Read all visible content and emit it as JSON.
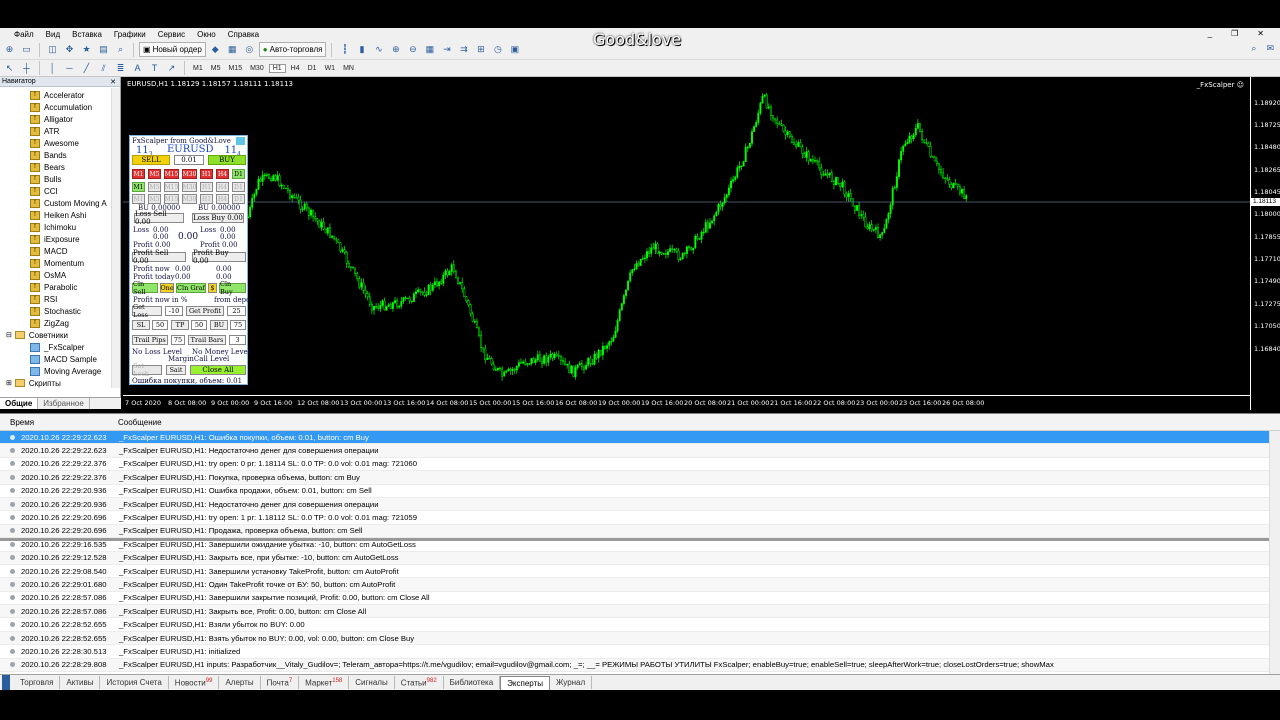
{
  "watermark": "Good&love",
  "menu": [
    "Файл",
    "Вид",
    "Вставка",
    "Графики",
    "Сервис",
    "Окно",
    "Справка"
  ],
  "toolbar": {
    "new_order": "Новый ордер",
    "auto_trading": "Авто-торговля",
    "timeframes": [
      "M1",
      "M5",
      "M15",
      "M30",
      "H1",
      "H4",
      "D1",
      "W1",
      "MN"
    ]
  },
  "navigator": {
    "title": "Навигатор",
    "indicators": [
      "Accelerator",
      "Accumulation",
      "Alligator",
      "ATR",
      "Awesome",
      "Bands",
      "Bears",
      "Bulls",
      "CCI",
      "Custom Moving A",
      "Heiken Ashi",
      "Ichimoku",
      "iExposure",
      "MACD",
      "Momentum",
      "OsMA",
      "Parabolic",
      "RSI",
      "Stochastic",
      "ZigZag"
    ],
    "advisors_folder": "Советники",
    "advisors": [
      "_FxScalper",
      "MACD Sample",
      "Moving Average"
    ],
    "scripts_folder": "Скрипты",
    "tabs": [
      "Общие",
      "Избранное"
    ]
  },
  "chart": {
    "info": "EURUSD,H1  1.18129 1.18157 1.18111 1.18113",
    "ea_name": "_FxScalper ☺",
    "current_price": "1.18113",
    "price_ticks": [
      "1.18920",
      "1.18725",
      "1.18480",
      "1.18265",
      "1.18045",
      "1.18000",
      "1.17855",
      "1.17710",
      "1.17490",
      "1.17275",
      "1.17050",
      "1.16840"
    ],
    "time_ticks": [
      "7 Oct 2020",
      "8 Oct 08:00",
      "9 Oct 00:00",
      "9 Oct 16:00",
      "12 Oct 08:00",
      "13 Oct 00:00",
      "13 Oct 16:00",
      "14 Oct 08:00",
      "15 Oct 00:00",
      "15 Oct 16:00",
      "16 Oct 08:00",
      "19 Oct 00:00",
      "19 Oct 16:00",
      "20 Oct 08:00",
      "21 Oct 00:00",
      "21 Oct 16:00",
      "22 Oct 08:00",
      "23 Oct 00:00",
      "23 Oct 16:00",
      "26 Oct 08:00"
    ]
  },
  "panel": {
    "title": "FxScalper from Good&Love",
    "bid_big": "11",
    "bid_small": "3",
    "symbol": "EURUSD",
    "ask_big": "11",
    "ask_small": "4",
    "sell": "SELL",
    "lot": "0.01",
    "buy": "BUY",
    "tf": [
      "M1",
      "M5",
      "M15",
      "M30",
      "H1",
      "H4",
      "D1"
    ],
    "bu_left": "BU  0.00000",
    "bu_right": "BU  0.00000",
    "loss_sell": "Loss Sell 0.00",
    "loss_buy": "Loss Buy 0.00",
    "loss_l": "Loss",
    "loss_l_v1": "0.00",
    "loss_l_v2": "0.00",
    "loss_mid": "0.00",
    "loss_r": "Loss",
    "loss_r_v1": "0.00",
    "loss_r_v2": "0.00",
    "profit_l": "Profit 0.00",
    "profit_r": "Profit 0.00",
    "profit_sell": "Profit Sell 0.00",
    "profit_buy": "Profit Buy 0.00",
    "profit_now": "Profit now",
    "profit_now_v1": "0.00",
    "profit_now_v2": "0.00",
    "profit_today": "Profit today",
    "profit_today_v1": "0.00",
    "profit_today_v2": "0.00",
    "cln_sell": "Cln Sell",
    "one": "One",
    "cln_graf": "Cln Graf",
    "dollar": "$",
    "cln_buy": "Cln Buy",
    "profit_now_pct": "Profit now in %",
    "from_depo": "from depo",
    "get_loss": "Get Loss",
    "get_loss_v": "-10",
    "get_profit": "Get Profit",
    "get_profit_v": "25",
    "sl": "SL",
    "sl_v": "50",
    "tp": "TP",
    "tp_v": "50",
    "bu": "BU",
    "bu_v": "75",
    "trail_pips": "Trail Pips",
    "trail_pips_v": "75",
    "trail_bars": "Trail Bars",
    "trail_bars_v": "3",
    "no_loss": "No Loss Level",
    "no_money": "No Money Level",
    "margin_call": "MarginCall Level",
    "set_lock": "Set Lock",
    "sait": "Sait",
    "close_all": "Close All",
    "status": "Ошибка покупки, объем: 0.01"
  },
  "log": {
    "col_time": "Время",
    "col_msg": "Сообщение",
    "rows": [
      {
        "time": "2020.10.26 22:29:22.623",
        "msg": "_FxScalper EURUSD,H1: Ошибка покупки, объем: 0.01, button: cm Buy"
      },
      {
        "time": "2020.10.26 22:29:22.623",
        "msg": "_FxScalper EURUSD,H1: Недостаточно денег для совершения операции"
      },
      {
        "time": "2020.10.26 22:29:22.376",
        "msg": "_FxScalper EURUSD,H1: try open: 0 pr: 1.18114 SL: 0.0 TP: 0.0 vol: 0.01 mag: 721060"
      },
      {
        "time": "2020.10.26 22:29:22.376",
        "msg": "_FxScalper EURUSD,H1: Покупка, проверка объема, button: cm Buy"
      },
      {
        "time": "2020.10.26 22:29:20.936",
        "msg": "_FxScalper EURUSD,H1: Ошибка продажи, объем: 0.01, button: cm Sell"
      },
      {
        "time": "2020.10.26 22:29:20.936",
        "msg": "_FxScalper EURUSD,H1: Недостаточно денег для совершения операции"
      },
      {
        "time": "2020.10.26 22:29:20.696",
        "msg": "_FxScalper EURUSD,H1: try open: 1 pr: 1.18112 SL: 0.0 TP: 0.0 vol: 0.01 mag: 721059"
      },
      {
        "time": "2020.10.26 22:29:20.696",
        "msg": "_FxScalper EURUSD,H1: Продажа, проверка объема, button: cm Sell"
      },
      {
        "time": "2020.10.26 22:29:16.535",
        "msg": "_FxScalper EURUSD,H1: Завершили ожидание убытка: -10, button: cm AutoGetLoss"
      },
      {
        "time": "2020.10.26 22:29:12.528",
        "msg": "_FxScalper EURUSD,H1: Закрыть все, при убытке: -10, button: cm AutoGetLoss"
      },
      {
        "time": "2020.10.26 22:29:08.540",
        "msg": "_FxScalper EURUSD,H1: Завершили установку TakeProfit, button: cm AutoProfit"
      },
      {
        "time": "2020.10.26 22:29:01.680",
        "msg": "_FxScalper EURUSD,H1: Один TakeProfit точке от БУ: 50, button: cm AutoProfit"
      },
      {
        "time": "2020.10.26 22:28:57.086",
        "msg": "_FxScalper EURUSD,H1: Завершили закрытие позиций, Profit: 0.00, button: cm Close All"
      },
      {
        "time": "2020.10.26 22:28:57.086",
        "msg": "_FxScalper EURUSD,H1: Закрыть все, Profit: 0.00, button: cm Close All"
      },
      {
        "time": "2020.10.26 22:28:52.655",
        "msg": "_FxScalper EURUSD,H1: Взяли убыток по BUY: 0.00"
      },
      {
        "time": "2020.10.26 22:28:52.655",
        "msg": "_FxScalper EURUSD,H1: Взять убыток по BUY: 0.00, vol: 0.00, button: cm Close Buy"
      },
      {
        "time": "2020.10.26 22:28:30.513",
        "msg": "_FxScalper EURUSD,H1: initialized"
      },
      {
        "time": "2020.10.26 22:28:29.808",
        "msg": "_FxScalper EURUSD,H1 inputs: Разработчик__Vitaly_Gudilov=; Teleram_автора=https://t.me/vgudilov; email=vgudilov@gmail.com; _=; __=  РЕЖИМЫ РАБОТЫ УТИЛИТЫ FxScalper; enableBuy=true; enableSell=true; sleepAfterWork=true; closeLostOrders=true; showMax"
      }
    ]
  },
  "bottom_tabs": [
    {
      "label": "Торговля",
      "badge": ""
    },
    {
      "label": "Активы",
      "badge": ""
    },
    {
      "label": "История Счета",
      "badge": ""
    },
    {
      "label": "Новости",
      "badge": "99"
    },
    {
      "label": "Алерты",
      "badge": ""
    },
    {
      "label": "Почта",
      "badge": "7"
    },
    {
      "label": "Маркет",
      "badge": "158"
    },
    {
      "label": "Сигналы",
      "badge": ""
    },
    {
      "label": "Статьи",
      "badge": "982"
    },
    {
      "label": "Библиотека",
      "badge": ""
    },
    {
      "label": "Эксперты",
      "badge": "",
      "active": true
    },
    {
      "label": "Журнал",
      "badge": ""
    }
  ],
  "colors": {
    "candle": "#00ff00",
    "selection": "#3399f3",
    "panel_border": "#80b3e0"
  }
}
